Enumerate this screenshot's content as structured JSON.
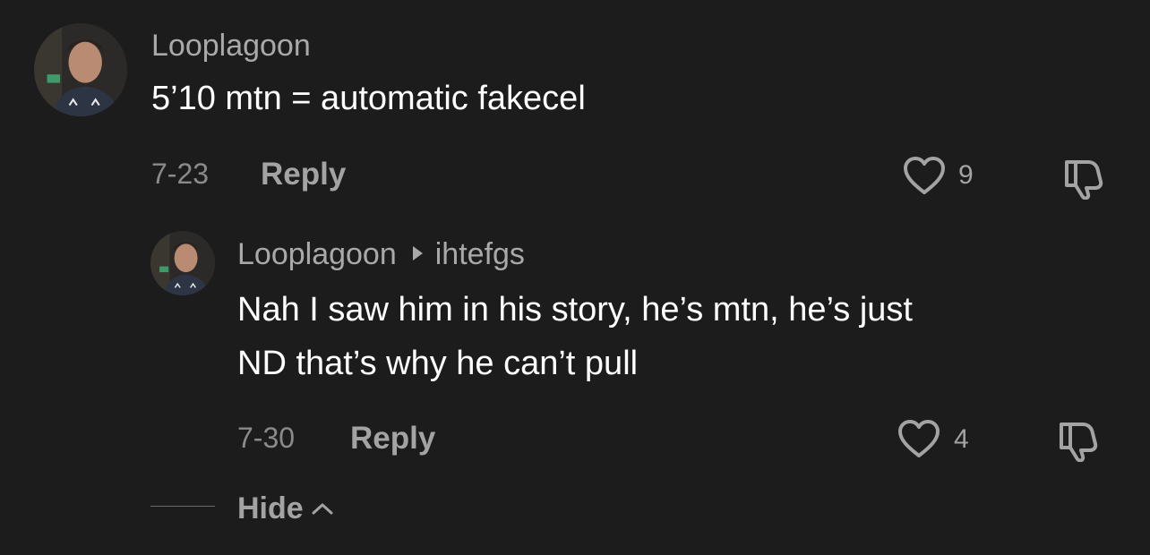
{
  "comment": {
    "username": "Looplagoon",
    "text": "5’10 mtn = automatic fakecel",
    "date": "7-23",
    "reply_label": "Reply",
    "likes": "9"
  },
  "reply": {
    "username": "Looplagoon",
    "reply_to": "ihtefgs",
    "text_line1": "Nah I saw him in his story, he’s mtn, he’s just",
    "text_line2": "ND that’s why he can’t pull",
    "date": "7-30",
    "reply_label": "Reply",
    "likes": "4"
  },
  "hide": {
    "label": "Hide"
  },
  "icons": {
    "avatar": "profile-photo",
    "like": "heart-outline-icon",
    "dislike": "thumbs-down-icon",
    "reply_arrow": "triangle-right-icon",
    "collapse": "chevron-up-icon"
  },
  "colors": {
    "background": "#1c1c1c",
    "text_primary": "#ffffff",
    "text_secondary": "#a9a9a9"
  }
}
